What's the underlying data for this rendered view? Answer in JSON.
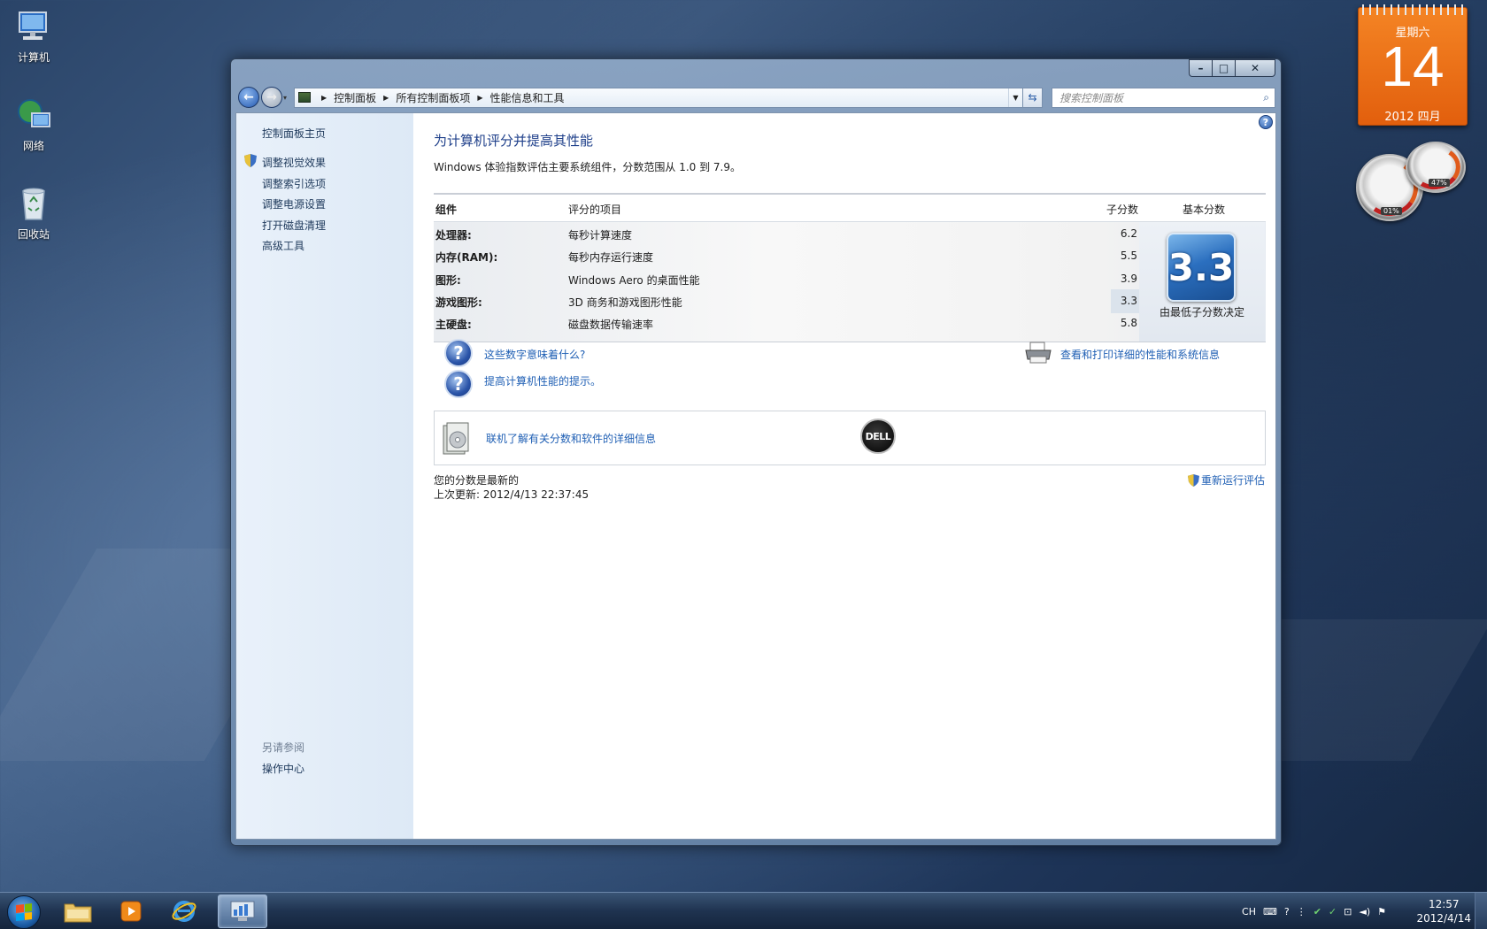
{
  "desktop": {
    "icons": [
      {
        "label": "计算机",
        "icon": "computer-icon"
      },
      {
        "label": "网络",
        "icon": "network-icon"
      },
      {
        "label": "回收站",
        "icon": "recycle-bin-icon"
      }
    ]
  },
  "window": {
    "address": {
      "crumbs": [
        "控制面板",
        "所有控制面板项",
        "性能信息和工具"
      ]
    },
    "search_placeholder": "搜索控制面板",
    "left_pane": {
      "home": "控制面板主页",
      "tasks": [
        "调整视觉效果",
        "调整索引选项",
        "调整电源设置",
        "打开磁盘清理",
        "高级工具"
      ],
      "see_also_heading": "另请参阅",
      "see_also": [
        "操作中心"
      ]
    },
    "main": {
      "title": "为计算机评分并提高其性能",
      "description": "Windows 体验指数评估主要系统组件，分数范围从 1.0 到 7.9。",
      "table": {
        "headers": {
          "component": "组件",
          "rated": "评分的项目",
          "subscore": "子分数",
          "base": "基本分数"
        },
        "rows": [
          {
            "component": "处理器:",
            "item": "每秒计算速度",
            "subscore": "6.2"
          },
          {
            "component": "内存(RAM):",
            "item": "每秒内存运行速度",
            "subscore": "5.5"
          },
          {
            "component": "图形:",
            "item": "Windows Aero 的桌面性能",
            "subscore": "3.9"
          },
          {
            "component": "游戏图形:",
            "item": "3D 商务和游戏图形性能",
            "subscore": "3.3"
          },
          {
            "component": "主硬盘:",
            "item": "磁盘数据传输速率",
            "subscore": "5.8"
          }
        ],
        "base_score": "3.3",
        "base_caption": "由最低子分数决定"
      },
      "links": {
        "what_numbers_mean": "这些数字意味着什么?",
        "tips": "提高计算机性能的提示。",
        "print_details": "查看和打印详细的性能和系统信息",
        "online_info": "联机了解有关分数和软件的详细信息"
      },
      "oem_logo_text": "DELL",
      "status": "您的分数是最新的",
      "last_update": "上次更新: 2012/4/13 22:37:45",
      "rerun": "重新运行评估"
    }
  },
  "gadgets": {
    "calendar": {
      "weekday": "星期六",
      "day": "14",
      "month_year": "2012 四月"
    },
    "cpu_meter": {
      "cpu": "01%",
      "ram": "47%"
    }
  },
  "taskbar": {
    "tray": {
      "lang": "CH"
    },
    "clock": {
      "time": "12:57",
      "date": "2012/4/14"
    }
  }
}
